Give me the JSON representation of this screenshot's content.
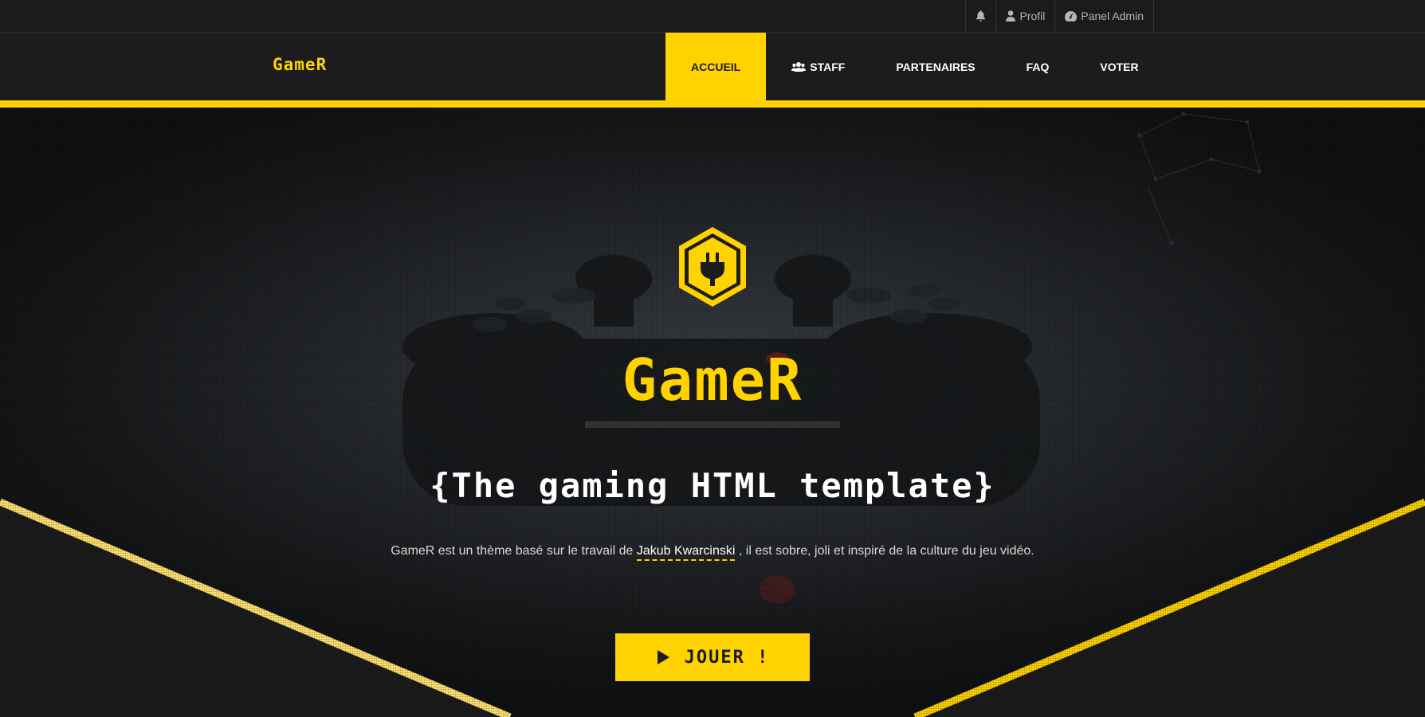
{
  "topbar": {
    "profile_label": "Profil",
    "admin_label": "Panel Admin"
  },
  "navbar": {
    "logo": "GameR",
    "items": [
      {
        "label": "ACCUEIL"
      },
      {
        "label": "STAFF"
      },
      {
        "label": "PARTENAIRES"
      },
      {
        "label": "FAQ"
      },
      {
        "label": "VOTER"
      }
    ]
  },
  "hero": {
    "title": "GameR",
    "subtitle": "{The gaming HTML template}",
    "desc_before": "GameR est un thème basé sur le travail de ",
    "desc_link": "Jakub Kwarcinski",
    "desc_after": " , il est sobre, joli et inspiré de la culture du jeu vidéo.",
    "cta_label": "JOUER !"
  },
  "colors": {
    "accent": "#ffd200",
    "background": "#1c1c1c"
  },
  "icons": [
    "bell-icon",
    "user-icon",
    "dashboard-icon",
    "users-icon",
    "plug-icon",
    "play-icon"
  ]
}
